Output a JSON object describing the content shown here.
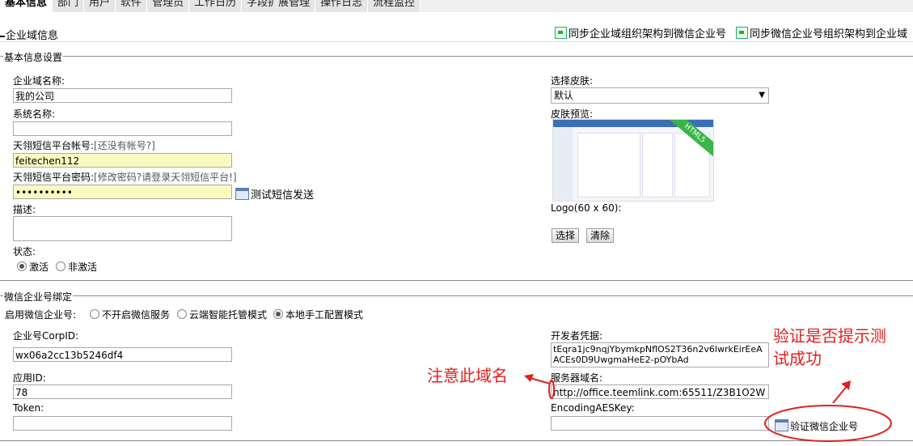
{
  "tabs": [
    "基本信息",
    "部门",
    "用户",
    "软件",
    "管理员",
    "工作日历",
    "字段扩展管理",
    "操作日志",
    "流程监控"
  ],
  "page_title": "企业域信息",
  "sync_buttons": [
    "同步企业域组织架构到微信企业号",
    "同步微信企业号组织架构到企业域"
  ],
  "basic": {
    "legend": "基本信息设置",
    "domain_name_label": "企业域名称:",
    "domain_name_value": "我的公司",
    "system_name_label": "系统名称:",
    "system_name_value": "",
    "sms_account_label": "天翎短信平台帐号:",
    "sms_account_link": "[还没有帐号?]",
    "sms_account_value": "feitechen112",
    "sms_password_label": "天翎短信平台密码:",
    "sms_password_link": "[修改密码?请登录天翎短信平台!]",
    "sms_password_value": "••••••••••",
    "test_sms_button": "测试短信发送",
    "description_label": "描述:",
    "status_label": "状态:",
    "status_options": [
      "激活",
      "非激活"
    ],
    "status_selected": "激活",
    "skin_label": "选择皮肤:",
    "skin_value": "默认",
    "skin_preview_label": "皮肤预览:",
    "skin_preview_badge": "HTML5",
    "logo_label": "Logo(60 x 60):",
    "choose_button": "选择",
    "clear_button": "清除"
  },
  "wechat": {
    "legend": "微信企业号绑定",
    "enable_label": "启用微信企业号:",
    "enable_options": [
      "不开启微信服务",
      "云端智能托管模式",
      "本地手工配置模式"
    ],
    "enable_selected": "本地手工配置模式",
    "corpid_label": "企业号CorpID:",
    "corpid_value": "wx06a2cc13b5246df4",
    "appid_label": "应用ID:",
    "appid_value": "78",
    "token_label": "Token:",
    "token_value": "",
    "dev_cred_label": "开发者凭据:",
    "dev_cred_value": "tEqra1jc9nqjYbymkpNflOS2T36n2v6lwrkEirEeAACEs0D9UwgmaHeE2-pOYbAd",
    "server_domain_label": "服务器域名:",
    "server_domain_value": "http://office.teemlink.com:65511/Z3B1O2W",
    "aes_key_label": "EncodingAESKey:",
    "aes_key_value": "",
    "verify_button": "验证微信企业号"
  },
  "annotations": {
    "note_domain": "注意此域名",
    "note_verify_line1": "验证是否提示测",
    "note_verify_line2": "试成功"
  },
  "colors": {
    "annotation": "#e02020",
    "yellow_field": "#fafac0",
    "ribbon": "#39b54a"
  }
}
